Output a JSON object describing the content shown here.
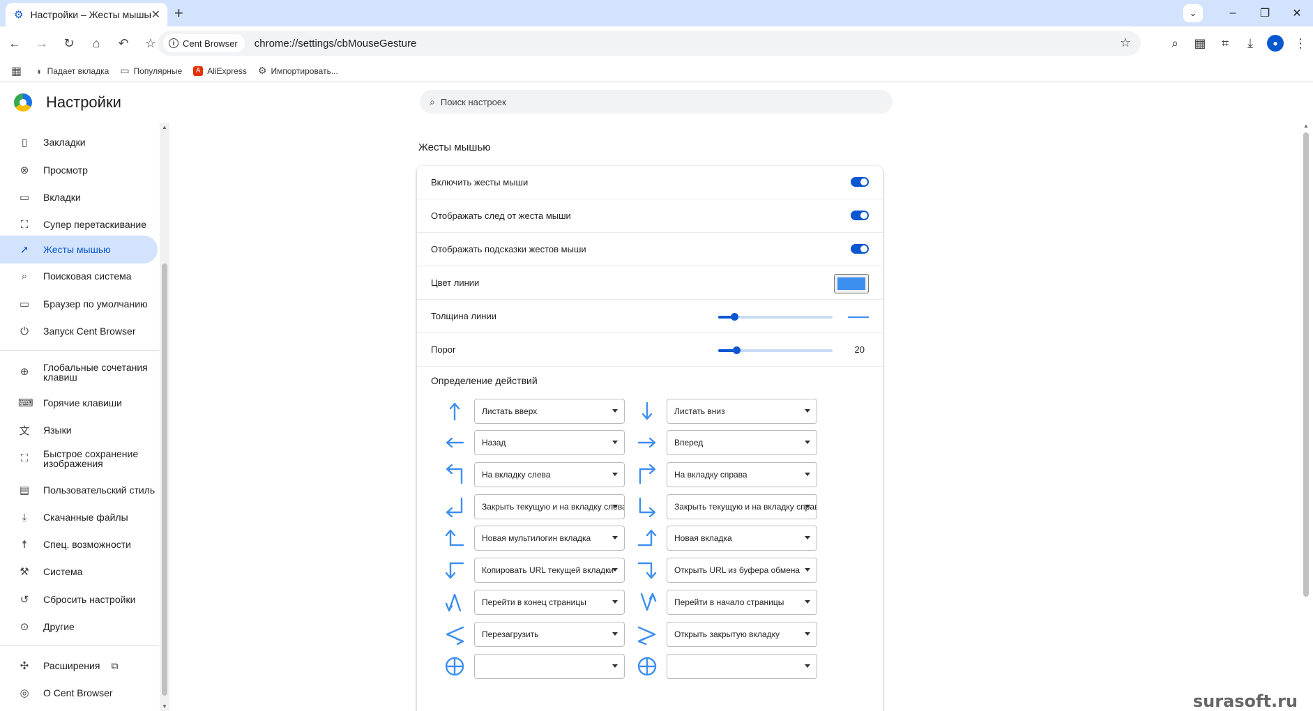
{
  "browser": {
    "tab_title": "Настройки – Жесты мышью",
    "url_chip": "Cent Browser",
    "url": "chrome://settings/cbMouseGesture",
    "bookmarks": [
      {
        "icon": "globe-icon",
        "label": "Падает вкладка"
      },
      {
        "icon": "folder-icon",
        "label": "Популярные"
      },
      {
        "icon": "aliexpress-icon",
        "label": "AliExpress"
      },
      {
        "icon": "gear-icon",
        "label": "Импортировать..."
      }
    ]
  },
  "settings": {
    "title": "Настройки",
    "search_placeholder": "Поиск настроек"
  },
  "sidebar": {
    "items": [
      {
        "icon": "bookmark-icon",
        "label": "Закладки"
      },
      {
        "icon": "view-icon",
        "label": "Просмотр"
      },
      {
        "icon": "tabs-icon",
        "label": "Вкладки"
      },
      {
        "icon": "drag-icon",
        "label": "Супер перетаскивание"
      },
      {
        "icon": "cursor-icon",
        "label": "Жесты мышью",
        "active": true
      },
      {
        "icon": "search-icon",
        "label": "Поисковая система"
      },
      {
        "icon": "browser-icon",
        "label": "Браузер по умолчанию"
      },
      {
        "icon": "power-icon",
        "label": "Запуск Cent Browser"
      },
      {
        "icon": "global-shortcut-icon",
        "label": "Глобальные сочетания клавиш"
      },
      {
        "icon": "keyboard-icon",
        "label": "Горячие клавиши"
      },
      {
        "icon": "translate-icon",
        "label": "Языки"
      },
      {
        "icon": "image-save-icon",
        "label": "Быстрое сохранение изображения"
      },
      {
        "icon": "style-icon",
        "label": "Пользовательский стиль"
      },
      {
        "icon": "download-icon",
        "label": "Скачанные файлы"
      },
      {
        "icon": "accessibility-icon",
        "label": "Спец. возможности"
      },
      {
        "icon": "wrench-icon",
        "label": "Система"
      },
      {
        "icon": "reset-icon",
        "label": "Сбросить настройки"
      },
      {
        "icon": "other-icon",
        "label": "Другие"
      },
      {
        "icon": "puzzle-icon",
        "label": "Расширения"
      },
      {
        "icon": "chrome-icon",
        "label": "О Cent Browser"
      }
    ]
  },
  "section": {
    "title": "Жесты мышью",
    "rows": {
      "enable": "Включить жесты мыши",
      "trail": "Отображать след от жеста мыши",
      "hints": "Отображать подсказки жестов мыши",
      "color": "Цвет линии",
      "thickness": "Толщина линии",
      "threshold": "Порог",
      "threshold_value": "20"
    },
    "line_color": "#3d8fef",
    "accent": "#0b57d0",
    "thickness_level": 0.14,
    "threshold_level": 0.16,
    "actions_title": "Определение действий",
    "gestures": [
      {
        "icon": "gesture-up-icon",
        "action": "Листать вверх"
      },
      {
        "icon": "gesture-down-icon",
        "action": "Листать вниз"
      },
      {
        "icon": "gesture-left-icon",
        "action": "Назад"
      },
      {
        "icon": "gesture-right-icon",
        "action": "Вперед"
      },
      {
        "icon": "gesture-up-left-icon",
        "action": "На вкладку слева"
      },
      {
        "icon": "gesture-up-right-icon",
        "action": "На вкладку справа"
      },
      {
        "icon": "gesture-down-left-icon",
        "action": "Закрыть текущую и на вкладку слева"
      },
      {
        "icon": "gesture-down-right-icon",
        "action": "Закрыть текущую и на вкладку справа"
      },
      {
        "icon": "gesture-left-up-icon",
        "action": "Новая мультилогин вкладка"
      },
      {
        "icon": "gesture-right-up-icon",
        "action": "Новая вкладка"
      },
      {
        "icon": "gesture-left-down-icon",
        "action": "Копировать URL текущей вкладки"
      },
      {
        "icon": "gesture-right-down-icon",
        "action": "Открыть URL из буфера обмена"
      },
      {
        "icon": "gesture-up-down-icon",
        "action": "Перейти в конец страницы"
      },
      {
        "icon": "gesture-down-up-icon",
        "action": "Перейти в начало страницы"
      },
      {
        "icon": "gesture-left-right-icon",
        "action": "Перезагрузить"
      },
      {
        "icon": "gesture-right-left-icon",
        "action": "Открыть закрытую вкладку"
      },
      {
        "icon": "gesture-circle-icon",
        "action": ""
      },
      {
        "icon": "gesture-circle-icon",
        "action": ""
      }
    ]
  },
  "watermark": "surasoft.ru"
}
